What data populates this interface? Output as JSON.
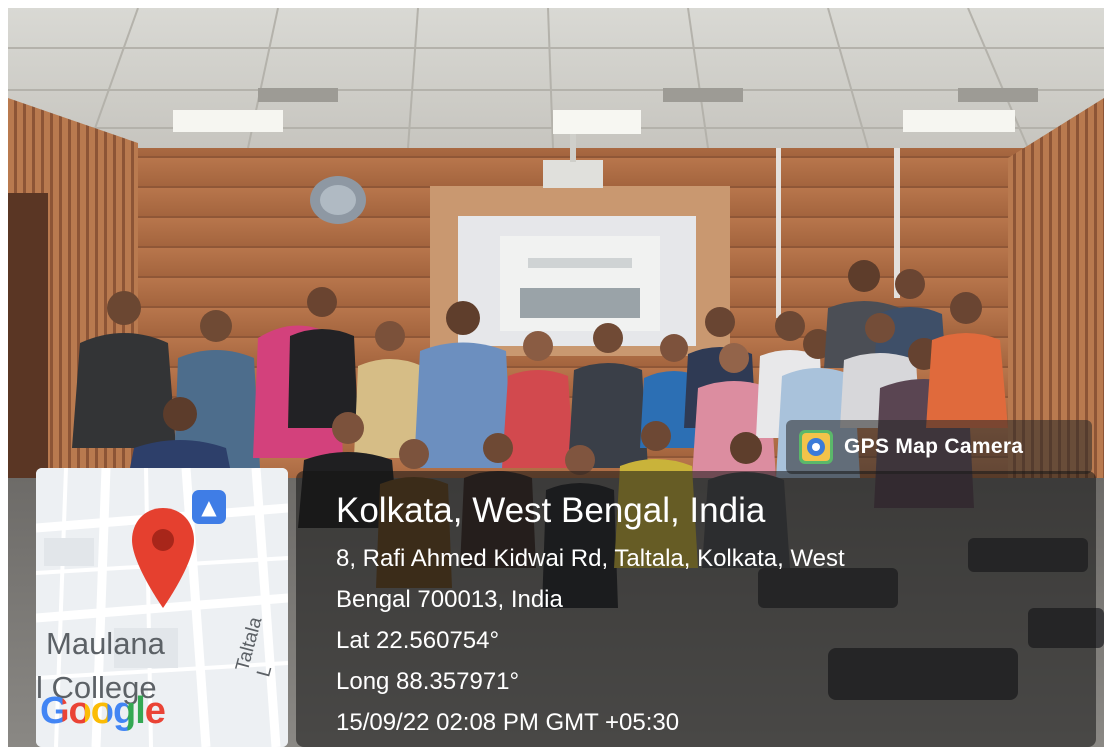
{
  "watermark": {
    "app_name": "GPS Map Camera",
    "app_icon": "map-camera-icon"
  },
  "location": {
    "place": "Kolkata, West Bengal, India",
    "address_line1": "8, Rafi Ahmed Kidwai Rd, Taltala, Kolkata, West",
    "address_line2": "Bengal 700013, India",
    "lat": "Lat 22.560754°",
    "long": "Long 88.357971°",
    "datetime": "15/09/22 02:08 PM GMT +05:30"
  },
  "map": {
    "label_maulana": "Maulana",
    "label_college": "l College",
    "label_street": "Taltala L",
    "brand": "Google",
    "pin_icon": "location-pin-icon",
    "poi_icon": "poi-icon"
  },
  "colors": {
    "pin": "#e5402f",
    "wall": "#b9774e",
    "panel": "#1e1e1e"
  }
}
